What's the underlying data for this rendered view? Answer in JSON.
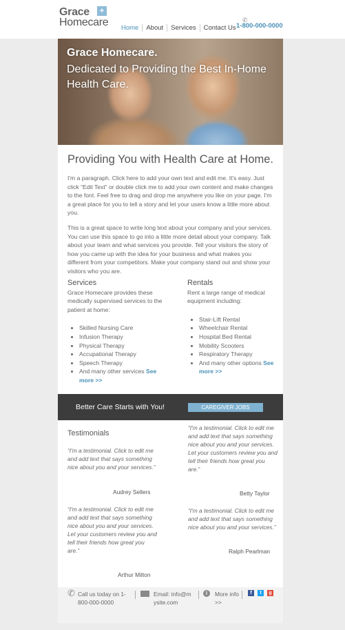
{
  "header": {
    "logo_line1": "Grace",
    "logo_line2": "Homecare",
    "logo_mark": "+",
    "nav": [
      "Home",
      "About",
      "Services",
      "Contact Us"
    ],
    "phone": "1-800-000-0000",
    "phone_icon": "phone-icon"
  },
  "hero": {
    "headline": "Grace Homecare.",
    "subhead": "Dedicated to Providing the Best In-Home Health Care."
  },
  "main": {
    "title": "Providing You with Health Care at Home.",
    "paragraph1": "I'm a paragraph. Click here to add your own text and edit me. It's easy. Just click “Edit Text” or double click me to add your own content and make changes to the font. Feel free to drag and drop me anywhere you like on your page. I'm a great place for you to tell a story and let your users know a little more about you.",
    "paragraph2": "This is a great space to write long text about your company and your services. You can use this space to go into a little more detail about your company. Talk about your team and what services you provide. Tell your visitors the story of how you came up with the idea for your business and what makes you different from your competitors. Make your company stand out and show your visitors who you are."
  },
  "services": {
    "heading": "Services",
    "intro": "Grace Homecare provides these medically supervised services to the patient at home:",
    "items": [
      "Skilled Nursing Care",
      "Infusion Therapy",
      "Physical Therapy",
      "Accupational Therapy",
      "Speech Therapy"
    ],
    "last_item": "And many other services",
    "see_more": "See more >>"
  },
  "rentals": {
    "heading": "Rentals",
    "intro": "Rent a large range of medical equipment including:",
    "items": [
      "Stair-Lift Rental",
      "Wheelchair Rental",
      "Hospital Bed Rental",
      "Mobility Scooters",
      "Respiratory Therapy"
    ],
    "last_item": "And many other options",
    "see_more": "See more >>"
  },
  "cta": {
    "text": "Better Care Starts with You!",
    "button": "CAREGIVER JOBS"
  },
  "testimonials": {
    "heading": "Testimonials",
    "items": [
      {
        "quote": "“I'm a testimonial. Click to edit me and add text that says something nice about you and your services.”",
        "author": "Audrey Sellers"
      },
      {
        "quote": "“I'm a testimonial. Click to edit me and add text that says something nice about you and your services. Let your customers review you and tell their friends how great you are.”",
        "author": "Arthur Milton"
      },
      {
        "quote": "“I'm a testimonial. Click to edit me and add text that says something nice about you and your services. Let your customers review you and tell their friends how great you are.”",
        "author": "Betty Taylor"
      },
      {
        "quote": "“I'm a testimonial. Click to edit me and add text that says something nice about you and your services.”",
        "author": "Ralph Pearlman"
      }
    ]
  },
  "footer": {
    "call": "Call us today on 1-800-000-0000",
    "email": "Email: info@mysite.com",
    "more": "More info >>",
    "social": [
      "f",
      "t",
      "g"
    ],
    "colors": {
      "facebook": "#3b5998",
      "twitter": "#1da1f2",
      "google": "#dd4b39"
    }
  }
}
